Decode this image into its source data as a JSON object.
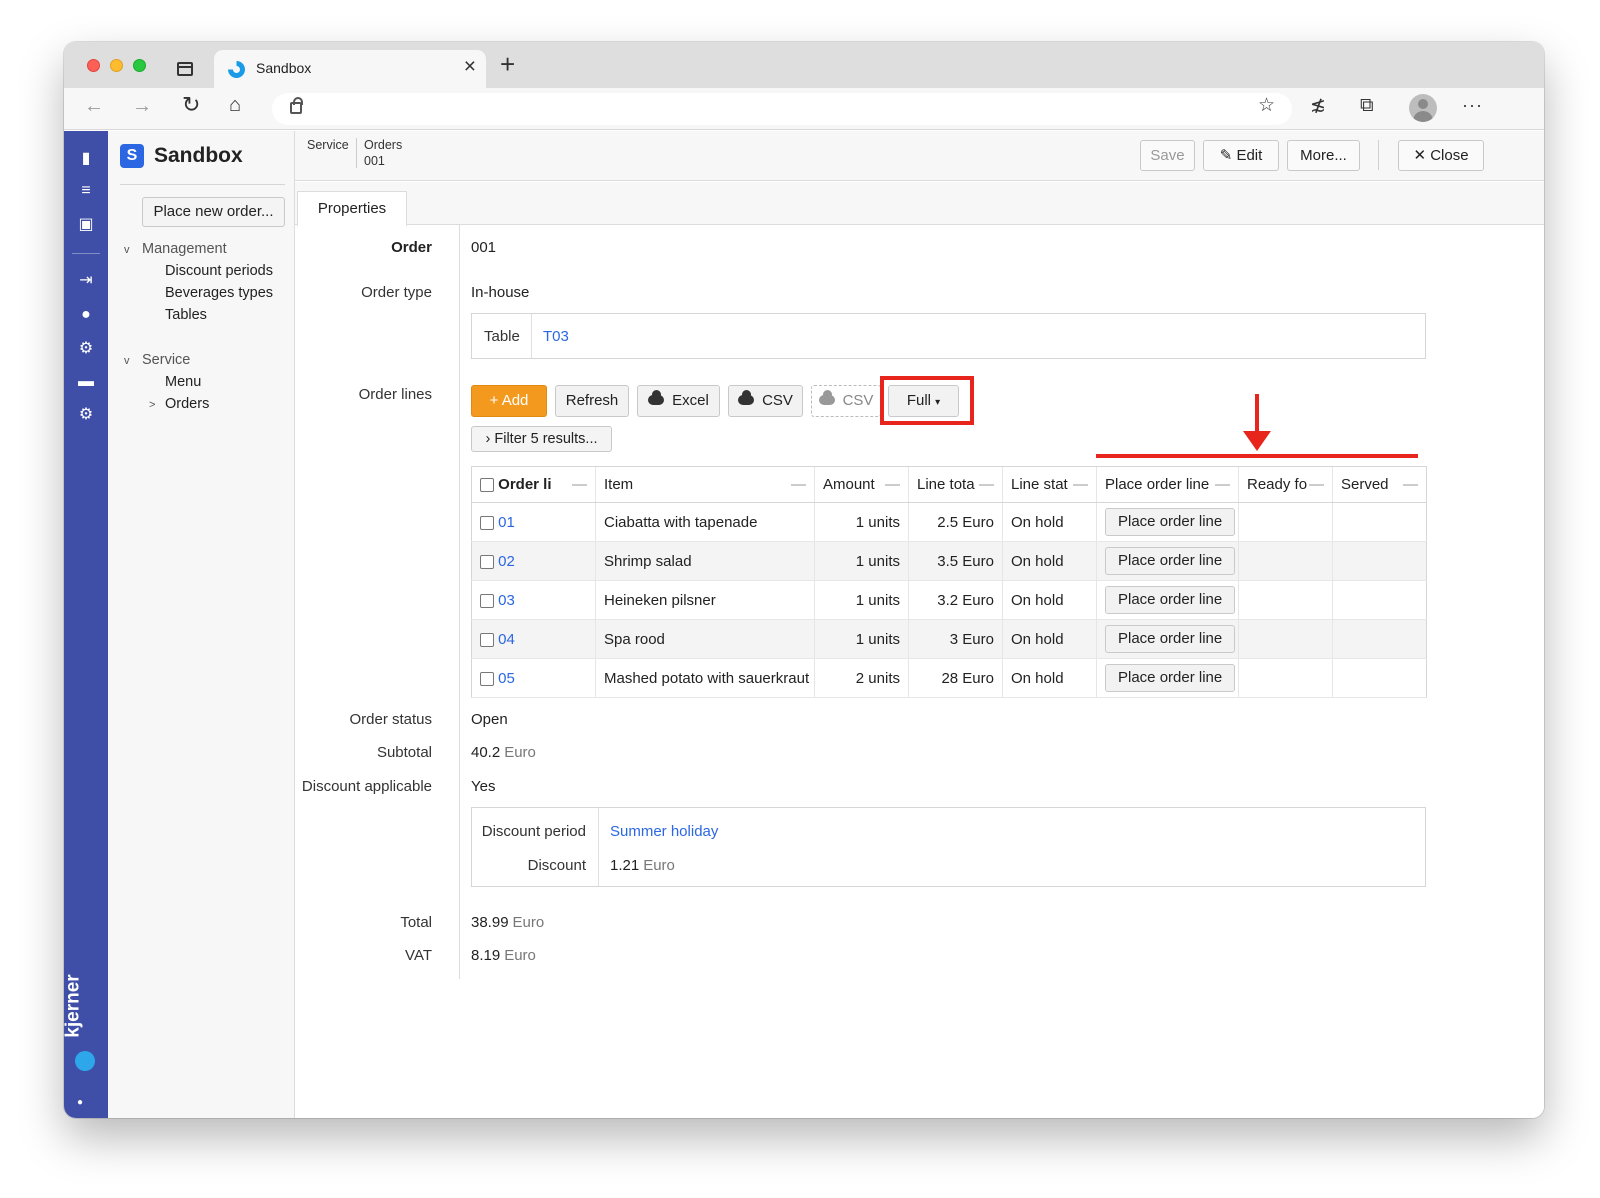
{
  "browser": {
    "tab_title": "Sandbox",
    "tab_close": "×",
    "new_tab": "+",
    "back": "←",
    "forward": "→",
    "reload": "↻",
    "home": "⌂",
    "star_add": "☆",
    "favorites": "≴",
    "collections": "⧉",
    "more": "···"
  },
  "leftbar": {
    "brand": "kjerner",
    "icons": [
      "document-icon",
      "list-check-icon",
      "window-icon",
      "sign-in-icon",
      "palette-icon",
      "globe-icon",
      "card-icon",
      "gear-icon"
    ]
  },
  "sidebar": {
    "logo_letter": "S",
    "app_name": "Sandbox",
    "place_new_order": "Place new order...",
    "groups": [
      {
        "label": "Management",
        "chevron": "v",
        "items": [
          "Discount periods",
          "Beverages types",
          "Tables"
        ]
      },
      {
        "label": "Service",
        "chevron": "v",
        "items": [
          "Menu",
          "Orders"
        ]
      }
    ],
    "orders_chevron": ">"
  },
  "topbar": {
    "crumb_module": "Service",
    "crumb_entity": "Orders",
    "crumb_record": "001",
    "save": "Save",
    "edit": "Edit",
    "more": "More...",
    "close": "Close"
  },
  "tabs": {
    "properties": "Properties"
  },
  "order": {
    "order_label": "Order",
    "order_value": "001",
    "type_label": "Order type",
    "type_value": "In-house",
    "table_label": "Table",
    "table_value": "T03",
    "lines_label": "Order lines",
    "toolbar": {
      "add": "Add",
      "refresh": "Refresh",
      "excel": "Excel",
      "csv": "CSV",
      "csv_disabled": "CSV",
      "full": "Full"
    },
    "filter": "Filter 5 results...",
    "columns": [
      "Order li",
      "Item",
      "Amount",
      "Line tota",
      "Line stat",
      "Place order line",
      "Ready fo",
      "Served"
    ],
    "lines": [
      {
        "id": "01",
        "item": "Ciabatta with tapenade",
        "amount": "1 units",
        "total": "2.5 Euro",
        "status": "On hold",
        "action": "Place order line"
      },
      {
        "id": "02",
        "item": "Shrimp salad",
        "amount": "1 units",
        "total": "3.5 Euro",
        "status": "On hold",
        "action": "Place order line"
      },
      {
        "id": "03",
        "item": "Heineken pilsner",
        "amount": "1 units",
        "total": "3.2 Euro",
        "status": "On hold",
        "action": "Place order line"
      },
      {
        "id": "04",
        "item": "Spa rood",
        "amount": "1 units",
        "total": "3 Euro",
        "status": "On hold",
        "action": "Place order line"
      },
      {
        "id": "05",
        "item": "Mashed potato with sauerkraut",
        "amount": "2 units",
        "total": "28 Euro",
        "status": "On hold",
        "action": "Place order line"
      }
    ],
    "status_label": "Order status",
    "status_value": "Open",
    "subtotal_label": "Subtotal",
    "subtotal_value": "40.2",
    "discount_applicable_label": "Discount applicable",
    "discount_applicable_value": "Yes",
    "discount_period_label": "Discount period",
    "discount_period_value": "Summer holiday",
    "discount_label": "Discount",
    "discount_value": "1.21",
    "total_label": "Total",
    "total_value": "38.99",
    "vat_label": "VAT",
    "vat_value": "8.19",
    "currency": "Euro"
  },
  "colors": {
    "primary": "#3f4fa7",
    "accent": "#f39a1e",
    "link": "#2b67e2",
    "annotation": "#e8251c"
  }
}
